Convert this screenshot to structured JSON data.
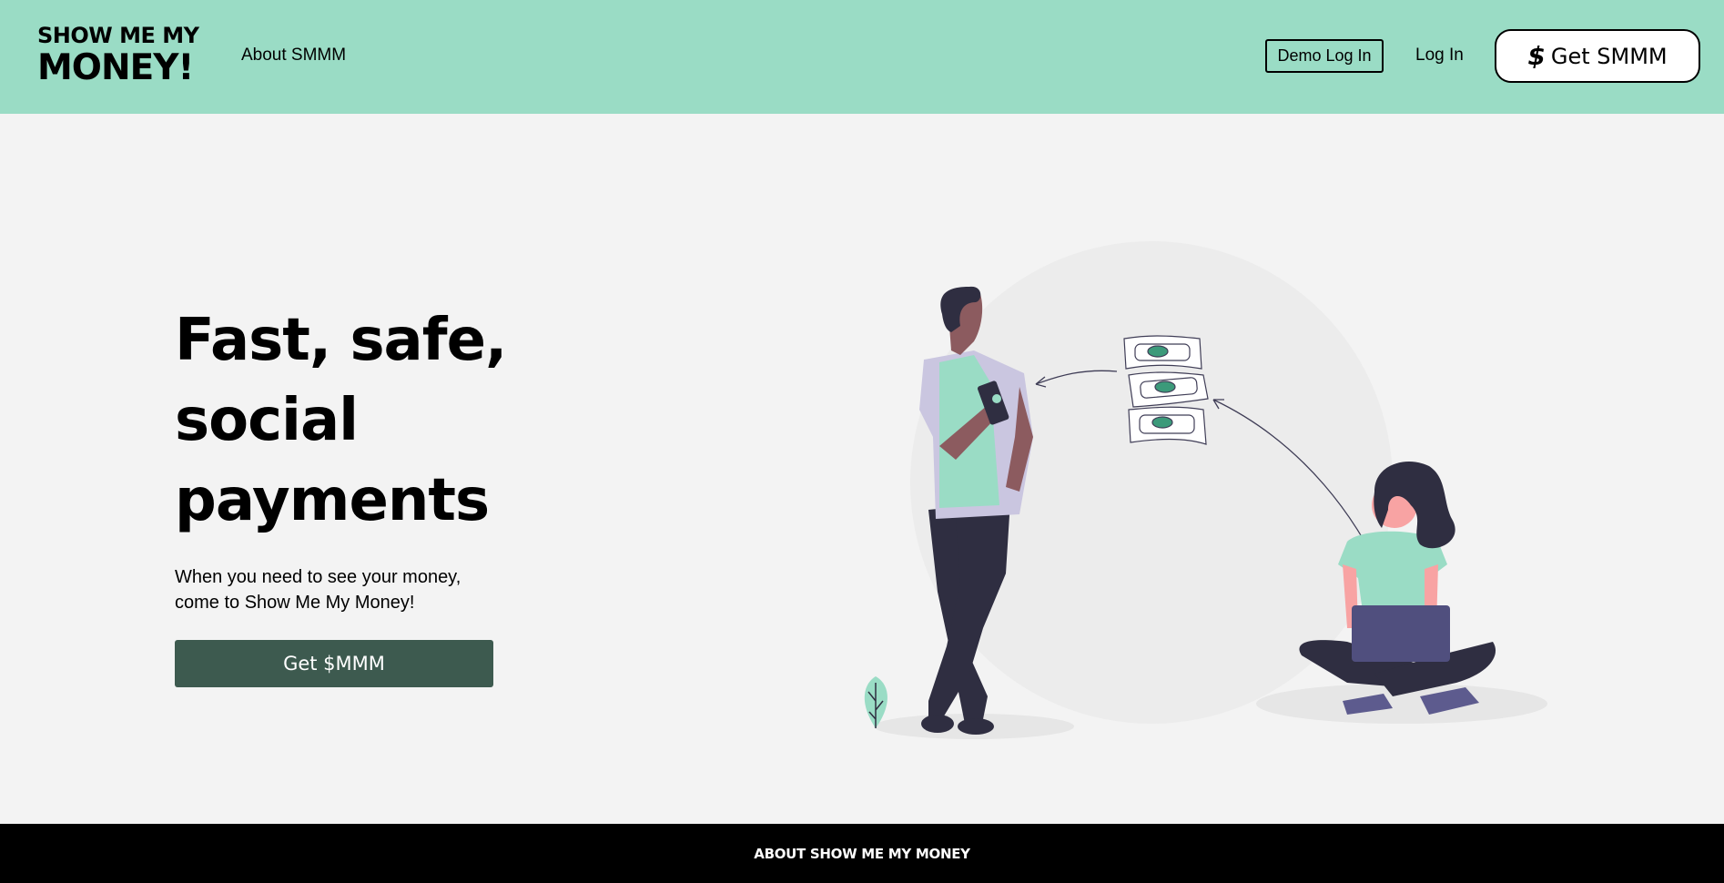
{
  "header": {
    "logo_line1": "SHOW ME MY",
    "logo_line2": "MONEY!",
    "nav_about": "About SMMM",
    "demo_login": "Demo Log In",
    "login": "Log In",
    "get_button": "Get SMMM",
    "get_button_icon": "dollar-icon"
  },
  "hero": {
    "title": "Fast, safe, social payments",
    "subtitle": "When you need to see your money, come to Show Me My Money!",
    "cta": "Get $MMM",
    "illustration": "people-exchanging-money-illustration"
  },
  "footer": {
    "link": "ABOUT SHOW ME MY MONEY"
  },
  "colors": {
    "header_bg": "#9adcc5",
    "page_bg": "#f3f3f3",
    "cta_bg": "#3d5a4f",
    "footer_bg": "#000000",
    "accent": "#9adcc5"
  }
}
